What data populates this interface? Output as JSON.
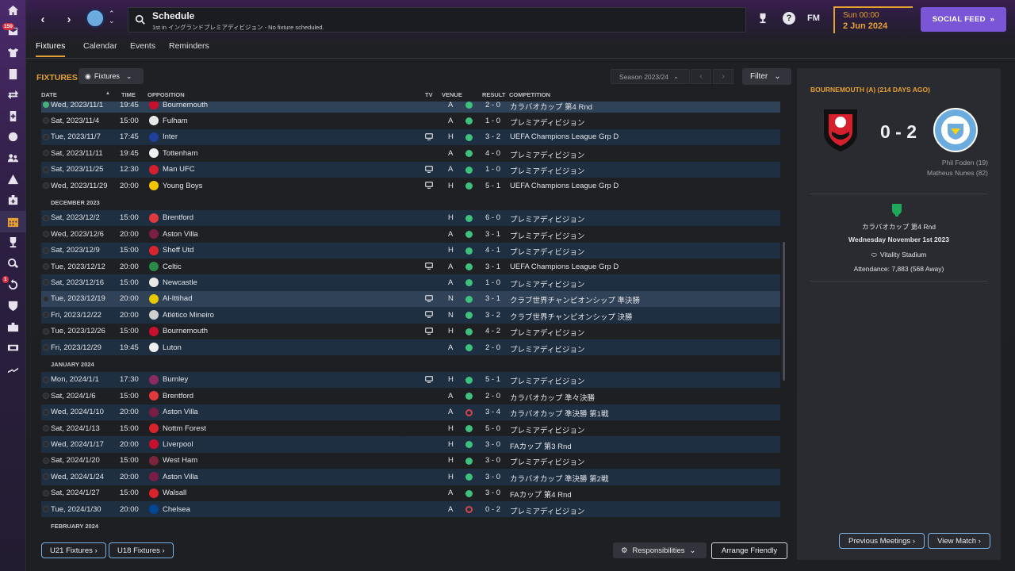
{
  "sidebar": {
    "items": [
      {
        "icon": "home-icon"
      },
      {
        "icon": "inbox-icon",
        "badge": "150"
      },
      {
        "icon": "squad-icon"
      },
      {
        "icon": "tactics-icon"
      },
      {
        "icon": "transfers-icon"
      },
      {
        "icon": "medical-icon"
      },
      {
        "icon": "data-hub-icon"
      },
      {
        "icon": "staff-icon"
      },
      {
        "icon": "training-icon"
      },
      {
        "icon": "club-vision-icon"
      },
      {
        "icon": "schedule-icon"
      },
      {
        "icon": "competitions-icon"
      },
      {
        "icon": "scouting-icon"
      },
      {
        "icon": "dev-centre-icon",
        "badge": "1"
      },
      {
        "icon": "club-info-icon"
      },
      {
        "icon": "finances-icon"
      },
      {
        "icon": "manager-icon"
      },
      {
        "icon": "continue-icon"
      }
    ]
  },
  "topbar": {
    "title": "Schedule",
    "subtitle": "1st in イングランドプレミアディビジョン - No fixture scheduled.",
    "fm_label": "FM",
    "time": "Sun 00:00",
    "date": "2 Jun 2024",
    "social_feed": "SOCIAL FEED"
  },
  "tabs": [
    "Fixtures",
    "Calendar",
    "Events",
    "Reminders"
  ],
  "fixtures": {
    "title": "FIXTURES",
    "dropdown": "Fixtures",
    "season": "Season 2023/24",
    "filter": "Filter",
    "columns": [
      "DATE",
      "TIME",
      "OPPOSITION",
      "TV",
      "VENUE",
      "RESULT",
      "COMPETITION"
    ],
    "rows": [
      {
        "type": "fixture",
        "date": "Wed, 2023/11/1",
        "time": "19:45",
        "opp": "Bournemouth",
        "crest": "#c8102e",
        "tv": false,
        "venue": "A",
        "result": "2 - 0",
        "comp": "カラバオカップ 第4 Rnd",
        "win": true,
        "hl": true,
        "played": true
      },
      {
        "type": "fixture",
        "date": "Sat, 2023/11/4",
        "time": "15:00",
        "opp": "Fulham",
        "crest": "#e8e8e8",
        "tv": false,
        "venue": "A",
        "result": "1 - 0",
        "comp": "プレミアディビジョン",
        "win": true
      },
      {
        "type": "fixture",
        "date": "Tue, 2023/11/7",
        "time": "17:45",
        "opp": "Inter",
        "crest": "#1e3f9a",
        "tv": true,
        "venue": "H",
        "result": "3 - 2",
        "comp": "UEFA Champions League Grp D",
        "win": true
      },
      {
        "type": "fixture",
        "date": "Sat, 2023/11/11",
        "time": "19:45",
        "opp": "Tottenham",
        "crest": "#f0f0f0",
        "tv": false,
        "venue": "A",
        "result": "4 - 0",
        "comp": "プレミアディビジョン",
        "win": true
      },
      {
        "type": "fixture",
        "date": "Sat, 2023/11/25",
        "time": "12:30",
        "opp": "Man UFC",
        "crest": "#d4202c",
        "tv": true,
        "venue": "A",
        "result": "1 - 0",
        "comp": "プレミアディビジョン",
        "win": true
      },
      {
        "type": "fixture",
        "date": "Wed, 2023/11/29",
        "time": "20:00",
        "opp": "Young Boys",
        "crest": "#f2c500",
        "tv": true,
        "venue": "H",
        "result": "5 - 1",
        "comp": "UEFA Champions League Grp D",
        "win": true
      },
      {
        "type": "month",
        "label": "DECEMBER 2023"
      },
      {
        "type": "fixture",
        "date": "Sat, 2023/12/2",
        "time": "15:00",
        "opp": "Brentford",
        "crest": "#e03a3e",
        "tv": false,
        "venue": "H",
        "result": "6 - 0",
        "comp": "プレミアディビジョン",
        "win": true
      },
      {
        "type": "fixture",
        "date": "Wed, 2023/12/6",
        "time": "20:00",
        "opp": "Aston Villa",
        "crest": "#7a1e46",
        "tv": false,
        "venue": "A",
        "result": "3 - 1",
        "comp": "プレミアディビジョン",
        "win": true
      },
      {
        "type": "fixture",
        "date": "Sat, 2023/12/9",
        "time": "15:00",
        "opp": "Sheff Utd",
        "crest": "#d9262e",
        "tv": false,
        "venue": "H",
        "result": "4 - 1",
        "comp": "プレミアディビジョン",
        "win": true
      },
      {
        "type": "fixture",
        "date": "Tue, 2023/12/12",
        "time": "20:00",
        "opp": "Celtic",
        "crest": "#2a8a4a",
        "tv": true,
        "venue": "A",
        "result": "3 - 1",
        "comp": "UEFA Champions League Grp D",
        "win": true
      },
      {
        "type": "fixture",
        "date": "Sat, 2023/12/16",
        "time": "15:00",
        "opp": "Newcastle",
        "crest": "#e8e8e8",
        "tv": false,
        "venue": "A",
        "result": "1 - 0",
        "comp": "プレミアディビジョン",
        "win": true
      },
      {
        "type": "fixture",
        "date": "Tue, 2023/12/19",
        "time": "20:00",
        "opp": "Al-Ittihad",
        "crest": "#e8c800",
        "tv": true,
        "venue": "N",
        "result": "3 - 1",
        "comp": "クラブ世界チャンピオンシップ 準決勝",
        "win": true,
        "hl": true
      },
      {
        "type": "fixture",
        "date": "Fri, 2023/12/22",
        "time": "20:00",
        "opp": "Atlético Mineiro",
        "crest": "#cfcfcf",
        "tv": true,
        "venue": "N",
        "result": "3 - 2",
        "comp": "クラブ世界チャンピオンシップ 決勝",
        "win": true
      },
      {
        "type": "fixture",
        "date": "Tue, 2023/12/26",
        "time": "15:00",
        "opp": "Bournemouth",
        "crest": "#c8102e",
        "tv": true,
        "venue": "H",
        "result": "4 - 2",
        "comp": "プレミアディビジョン",
        "win": true
      },
      {
        "type": "fixture",
        "date": "Fri, 2023/12/29",
        "time": "19:45",
        "opp": "Luton",
        "crest": "#f0f0f0",
        "tv": false,
        "venue": "A",
        "result": "2 - 0",
        "comp": "プレミアディビジョン",
        "win": true
      },
      {
        "type": "month",
        "label": "JANUARY 2024"
      },
      {
        "type": "fixture",
        "date": "Mon, 2024/1/1",
        "time": "17:30",
        "opp": "Burnley",
        "crest": "#8a2b63",
        "tv": true,
        "venue": "H",
        "result": "5 - 1",
        "comp": "プレミアディビジョン",
        "win": true
      },
      {
        "type": "fixture",
        "date": "Sat, 2024/1/6",
        "time": "15:00",
        "opp": "Brentford",
        "crest": "#e03a3e",
        "tv": false,
        "venue": "A",
        "result": "2 - 0",
        "comp": "カラバオカップ 準々決勝",
        "win": true
      },
      {
        "type": "fixture",
        "date": "Wed, 2024/1/10",
        "time": "20:00",
        "opp": "Aston Villa",
        "crest": "#7a1e46",
        "tv": false,
        "venue": "A",
        "result": "3 - 4",
        "comp": "カラバオカップ 準決勝 第1戦",
        "win": false
      },
      {
        "type": "fixture",
        "date": "Sat, 2024/1/13",
        "time": "15:00",
        "opp": "Nottm Forest",
        "crest": "#d8232a",
        "tv": false,
        "venue": "H",
        "result": "5 - 0",
        "comp": "プレミアディビジョン",
        "win": true
      },
      {
        "type": "fixture",
        "date": "Wed, 2024/1/17",
        "time": "20:00",
        "opp": "Liverpool",
        "crest": "#c8102e",
        "tv": false,
        "venue": "H",
        "result": "3 - 0",
        "comp": "FAカップ 第3 Rnd",
        "win": true
      },
      {
        "type": "fixture",
        "date": "Sat, 2024/1/20",
        "time": "15:00",
        "opp": "West Ham",
        "crest": "#7a263a",
        "tv": false,
        "venue": "H",
        "result": "3 - 0",
        "comp": "プレミアディビジョン",
        "win": true
      },
      {
        "type": "fixture",
        "date": "Wed, 2024/1/24",
        "time": "20:00",
        "opp": "Aston Villa",
        "crest": "#7a1e46",
        "tv": false,
        "venue": "H",
        "result": "3 - 0",
        "comp": "カラバオカップ 準決勝 第2戦",
        "win": true
      },
      {
        "type": "fixture",
        "date": "Sat, 2024/1/27",
        "time": "15:00",
        "opp": "Walsall",
        "crest": "#d8232a",
        "tv": false,
        "venue": "A",
        "result": "3 - 0",
        "comp": "FAカップ 第4 Rnd",
        "win": true
      },
      {
        "type": "fixture",
        "date": "Tue, 2024/1/30",
        "time": "20:00",
        "opp": "Chelsea",
        "crest": "#034694",
        "tv": false,
        "venue": "A",
        "result": "0 - 2",
        "comp": "プレミアディビジョン",
        "win": false
      },
      {
        "type": "month",
        "label": "FEBRUARY 2024"
      }
    ],
    "u21_button": "U21 Fixtures",
    "u18_button": "U18 Fixtures",
    "responsibilities": "Responsibilities",
    "arrange_friendly": "Arrange Friendly"
  },
  "match_card": {
    "title": "BOURNEMOUTH (A) (214 DAYS AGO)",
    "score": "0 - 2",
    "scorers": [
      "Phil Foden (19)",
      "Matheus Nunes (82)"
    ],
    "competition": "カラバオカップ 第4 Rnd",
    "date": "Wednesday November 1st 2023",
    "stadium": "Vitality Stadium",
    "attendance": "Attendance: 7,883 (568 Away)",
    "previous_meetings": "Previous Meetings",
    "view_match": "View Match"
  },
  "colors": {
    "accent": "#e5a034",
    "social": "#7a55d6",
    "win": "#3fc17e",
    "loss": "#d7434e"
  }
}
